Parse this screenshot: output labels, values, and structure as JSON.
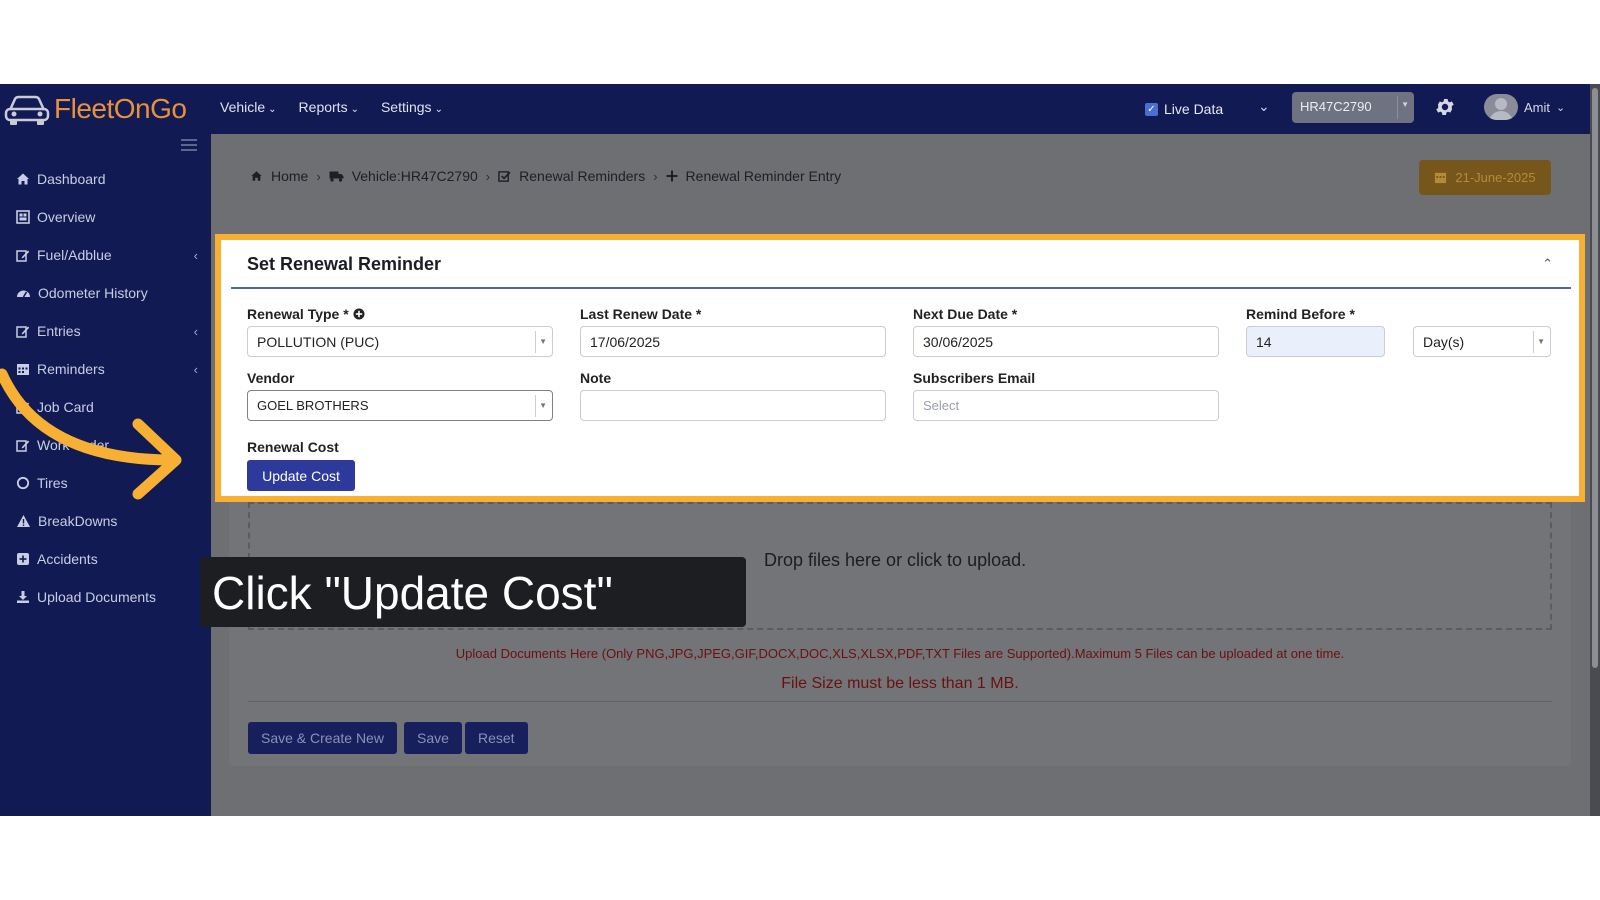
{
  "brand": {
    "name": "FleetOnGo"
  },
  "nav": {
    "menu": [
      {
        "label": "Vehicle"
      },
      {
        "label": "Reports"
      },
      {
        "label": "Settings"
      }
    ],
    "live_data_label": "Live Data",
    "vehicle_selected": "HR47C2790",
    "user_name": "Amit"
  },
  "sidebar": {
    "items": [
      {
        "label": "Dashboard",
        "icon": "home-icon",
        "has_children": false
      },
      {
        "label": "Overview",
        "icon": "grid-icon",
        "has_children": false
      },
      {
        "label": "Fuel/Adblue",
        "icon": "edit-icon",
        "has_children": true
      },
      {
        "label": "Odometer History",
        "icon": "gauge-icon",
        "has_children": false
      },
      {
        "label": "Entries",
        "icon": "edit-icon",
        "has_children": true
      },
      {
        "label": "Reminders",
        "icon": "calendar-icon",
        "has_children": true
      },
      {
        "label": "Job Card",
        "icon": "edit-icon",
        "has_children": false
      },
      {
        "label": "Work Order",
        "icon": "edit-icon",
        "has_children": false
      },
      {
        "label": "Tires",
        "icon": "circle-icon",
        "has_children": false
      },
      {
        "label": "BreakDowns",
        "icon": "warning-icon",
        "has_children": false
      },
      {
        "label": "Accidents",
        "icon": "plus-square-icon",
        "has_children": false
      },
      {
        "label": "Upload Documents",
        "icon": "download-icon",
        "has_children": false
      }
    ]
  },
  "breadcrumb": {
    "items": [
      "Home",
      "Vehicle:HR47C2790",
      "Renewal Reminders",
      "Renewal Reminder Entry"
    ]
  },
  "date_badge": "21-June-2025",
  "form": {
    "title": "Set Renewal Reminder",
    "renewal_type": {
      "label": "Renewal Type *",
      "value": "POLLUTION (PUC)"
    },
    "last_renew_date": {
      "label": "Last Renew Date *",
      "value": "17/06/2025"
    },
    "next_due_date": {
      "label": "Next Due Date *",
      "value": "30/06/2025"
    },
    "remind_before": {
      "label": "Remind Before *",
      "value": "14",
      "unit": "Day(s)"
    },
    "vendor": {
      "label": "Vendor",
      "value": "GOEL BROTHERS"
    },
    "note": {
      "label": "Note",
      "value": ""
    },
    "subscribers_email": {
      "label": "Subscribers Email",
      "placeholder": "Select"
    },
    "renewal_cost": {
      "label": "Renewal Cost",
      "button": "Update Cost"
    }
  },
  "upload": {
    "drop_text": "Drop files here or click to upload.",
    "info": "Upload Documents Here (Only PNG,JPG,JPEG,GIF,DOCX,DOC,XLS,XLSX,PDF,TXT Files are Supported).Maximum 5 Files can be uploaded at one time.",
    "size_note": "File Size must be less than 1 MB."
  },
  "actions": {
    "save_create_new": "Save & Create New",
    "save": "Save",
    "reset": "Reset"
  },
  "tooltip": {
    "text": "Click \"Update Cost\""
  },
  "colors": {
    "navy": "#111a52",
    "highlight": "#f7b033",
    "primary_button": "#2d3a9c",
    "error_text": "#b82020"
  }
}
